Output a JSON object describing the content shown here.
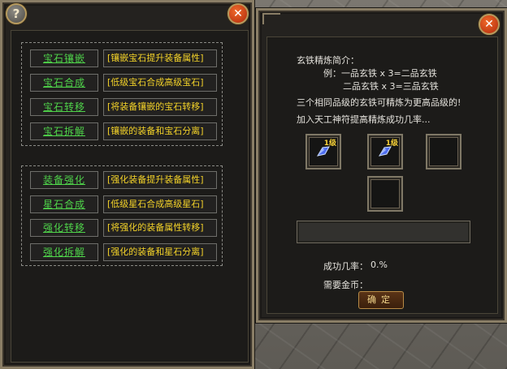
{
  "left_panel": {
    "help_icon_glyph": "?",
    "close_icon_glyph": "✕",
    "group1": [
      {
        "label": "宝石镶嵌",
        "desc": "[镶嵌宝石提升装备属性]"
      },
      {
        "label": "宝石合成",
        "desc": "[低级宝石合成高级宝石]"
      },
      {
        "label": "宝石转移",
        "desc": "[将装备镶嵌的宝石转移]"
      },
      {
        "label": "宝石拆解",
        "desc": "[镶嵌的装备和宝石分离]"
      }
    ],
    "group2": [
      {
        "label": "装备强化",
        "desc": "[强化装备提升装备属性]"
      },
      {
        "label": "星石合成",
        "desc": "[低级星石合成高级星石]"
      },
      {
        "label": "强化转移",
        "desc": "[将强化的装备属性转移]"
      },
      {
        "label": "强化拆解",
        "desc": "[强化的装备和星石分离]"
      }
    ]
  },
  "right_panel": {
    "close_icon_glyph": "✕",
    "intro_title": "玄铁精炼简介：",
    "intro_line1": "例：一品玄铁 x 3=二品玄铁",
    "intro_line2": "二品玄铁 x 3=三品玄铁",
    "intro_line3": "三个相同品级的玄铁可精炼为更高品级的!",
    "intro_line4": "加入天工神符提高精炼成功几率...",
    "slots": [
      {
        "level": "1级",
        "item": "blue-crystal-icon"
      },
      {
        "level": "1级",
        "item": "blue-crystal-icon"
      },
      {
        "level": "",
        "item": ""
      },
      {
        "level": "",
        "item": ""
      }
    ],
    "success_rate_label": "成功几率：",
    "success_rate_value": "0.%",
    "gold_label": "需要金币：",
    "gold_value": "",
    "confirm_label": "确定"
  },
  "colors": {
    "menu_label": "#4fd34a",
    "menu_desc": "#f3d229",
    "level_badge": "#f7d23b"
  }
}
